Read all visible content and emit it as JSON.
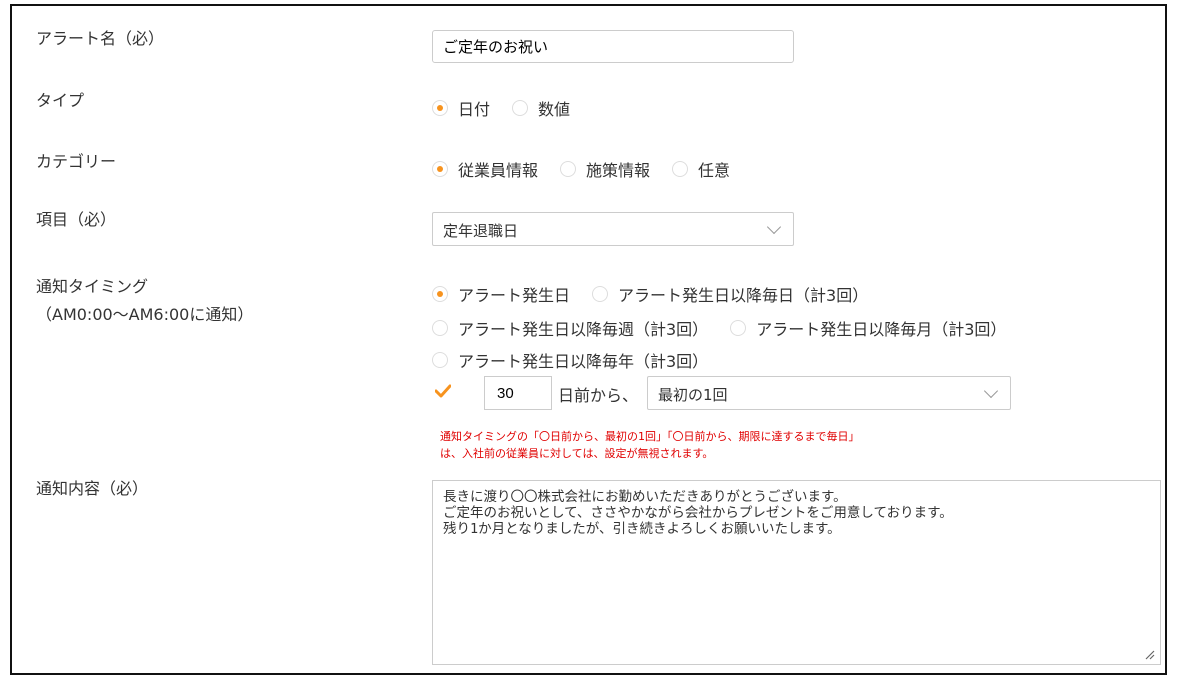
{
  "form": {
    "alert_name_label": "アラート名（必）",
    "alert_name_value": "ご定年のお祝い",
    "type_label": "タイプ",
    "type_options": [
      {
        "label": "日付",
        "selected": true
      },
      {
        "label": "数値",
        "selected": false
      }
    ],
    "category_label": "カテゴリー",
    "category_options": [
      {
        "label": "従業員情報",
        "selected": true
      },
      {
        "label": "施策情報",
        "selected": false
      },
      {
        "label": "任意",
        "selected": false
      }
    ],
    "item_label": "項目（必）",
    "item_value": "定年退職日",
    "timing_label": "通知タイミング",
    "timing_sublabel": "（AM0:00〜AM6:00に通知）",
    "timing_options": [
      {
        "label": "アラート発生日",
        "selected": true
      },
      {
        "label": "アラート発生日以降毎日（計3回）",
        "selected": false
      },
      {
        "label": "アラート発生日以降毎週（計3回）",
        "selected": false
      },
      {
        "label": "アラート発生日以降毎月（計3回）",
        "selected": false
      },
      {
        "label": "アラート発生日以降毎年（計3回）",
        "selected": false
      }
    ],
    "advance_checked": true,
    "advance_days": "30",
    "advance_suffix": "日前から、",
    "advance_mode": "最初の1回",
    "note_line1": "通知タイミングの「〇日前から、最初の1回」「〇日前から、期限に達するまで毎日」",
    "note_line2": "は、入社前の従業員に対しては、設定が無視されます。",
    "content_label": "通知内容（必）",
    "content_value": "長きに渡り〇〇株式会社にお勤めいただきありがとうございます。\nご定年のお祝いとして、ささやかながら会社からプレゼントをご用意しております。\n残り1か月となりましたが、引き続きよろしくお願いいたします。"
  },
  "colors": {
    "accent": "#f7931e",
    "warning": "#e00000",
    "border": "#cccccc"
  },
  "icons": {
    "select": "chevron-down-icon",
    "check": "checkmark-icon",
    "resize": "resize-grip-icon"
  }
}
